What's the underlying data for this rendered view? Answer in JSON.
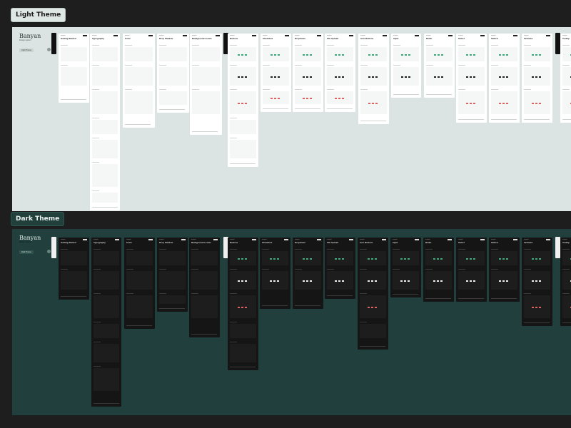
{
  "sections": {
    "light": {
      "label": "Light Theme",
      "cover": {
        "brand": "Banyan",
        "subtitle": "Design system",
        "theme_pill": "Light Theme",
        "tag": "Foundations"
      }
    },
    "dark": {
      "label": "Dark Theme",
      "cover": {
        "brand": "Banyan",
        "subtitle": "Design system",
        "theme_pill": "Dark Theme",
        "tag": "Foundations"
      }
    }
  },
  "frame_header": "Banyan",
  "frames": [
    {
      "title": "Getting Started",
      "group": "foundations"
    },
    {
      "title": "Typography",
      "group": "foundations"
    },
    {
      "title": "Color",
      "group": "foundations"
    },
    {
      "title": "Drop Shadow",
      "group": "foundations"
    },
    {
      "title": "Background Levels",
      "group": "foundations"
    },
    {
      "title": "Buttons",
      "group": "components"
    },
    {
      "title": "Checkbox",
      "group": "components"
    },
    {
      "title": "Dropdown",
      "group": "components"
    },
    {
      "title": "File Upload",
      "group": "components"
    },
    {
      "title": "Icon Buttons",
      "group": "components"
    },
    {
      "title": "Input",
      "group": "components"
    },
    {
      "title": "Radio",
      "group": "components"
    },
    {
      "title": "Select",
      "group": "components"
    },
    {
      "title": "Switch",
      "group": "components"
    },
    {
      "title": "Textarea",
      "group": "components"
    },
    {
      "title": "Tooltip",
      "group": "components"
    }
  ],
  "components_tag": "Components",
  "colors": {
    "accent_green": "#3fa77a",
    "accent_red": "#e06060",
    "accent_orange": "#f0a060"
  }
}
